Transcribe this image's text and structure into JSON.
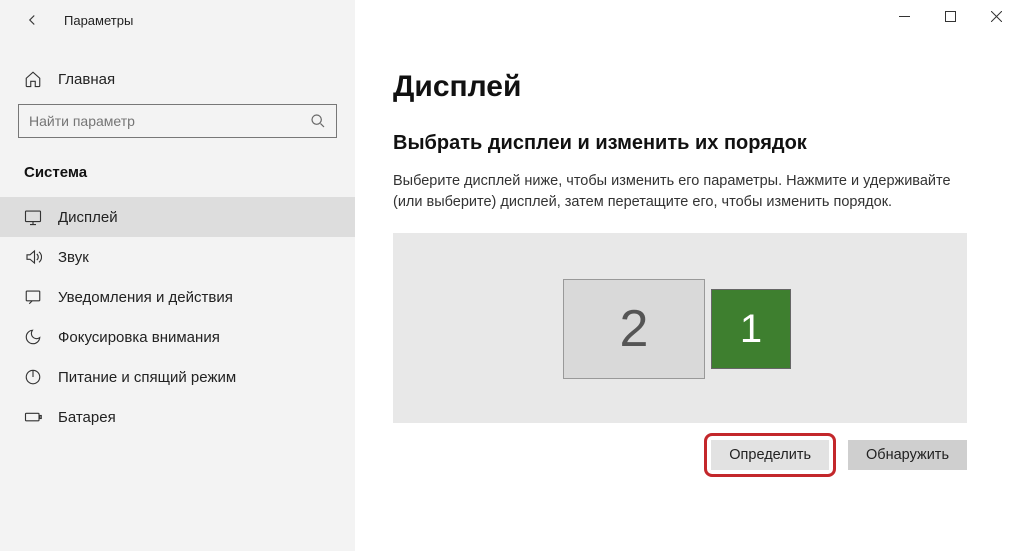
{
  "titlebar": {
    "title": "Параметры"
  },
  "sidebar": {
    "home_label": "Главная",
    "search_placeholder": "Найти параметр",
    "section_title": "Система",
    "items": [
      {
        "label": "Дисплей"
      },
      {
        "label": "Звук"
      },
      {
        "label": "Уведомления и действия"
      },
      {
        "label": "Фокусировка внимания"
      },
      {
        "label": "Питание и спящий режим"
      },
      {
        "label": "Батарея"
      }
    ]
  },
  "main": {
    "page_title": "Дисплей",
    "section_heading": "Выбрать дисплеи и изменить их порядок",
    "section_desc": "Выберите дисплей ниже, чтобы изменить его параметры. Нажмите и удерживайте (или выберите) дисплей, затем перетащите его, чтобы изменить порядок.",
    "monitors": {
      "primary_label": "1",
      "secondary_label": "2",
      "primary_color": "#3e7f2f",
      "secondary_color": "#d9d9d9"
    },
    "buttons": {
      "identify": "Определить",
      "detect": "Обнаружить"
    }
  }
}
